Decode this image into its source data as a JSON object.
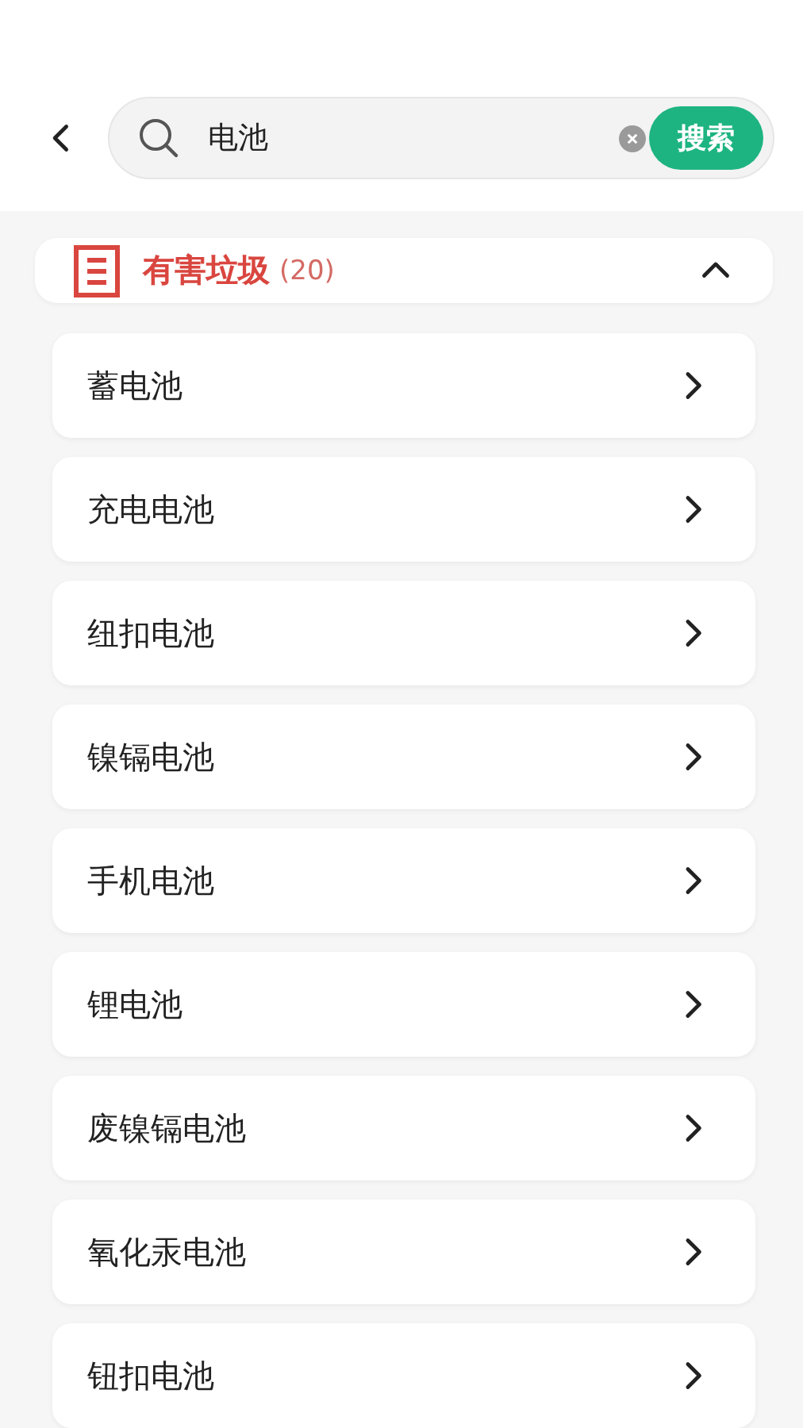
{
  "search": {
    "value": "电池",
    "button": "搜索"
  },
  "category": {
    "name": "有害垃圾",
    "count": "(20)",
    "expanded": true
  },
  "items": [
    {
      "label": "蓄电池"
    },
    {
      "label": "充电电池"
    },
    {
      "label": "纽扣电池"
    },
    {
      "label": "镍镉电池"
    },
    {
      "label": "手机电池"
    },
    {
      "label": "锂电池"
    },
    {
      "label": "废镍镉电池"
    },
    {
      "label": "氧化汞电池"
    },
    {
      "label": "钮扣电池"
    }
  ]
}
